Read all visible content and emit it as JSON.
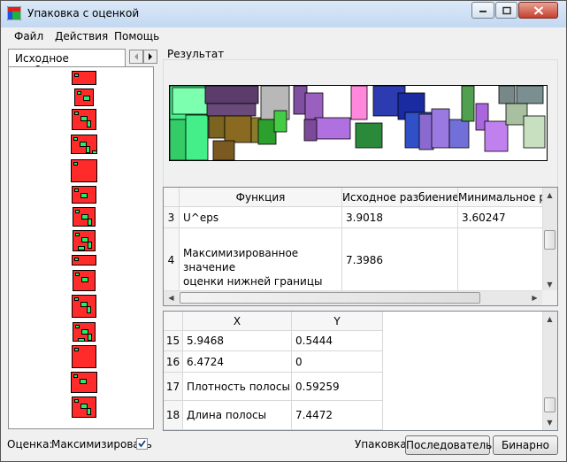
{
  "window": {
    "title": "Упаковка с оценкой"
  },
  "menu": [
    "Файл",
    "Действия",
    "Помощь"
  ],
  "left_tab": {
    "label": "Исходное разбиение"
  },
  "result_group": {
    "label": "Результат"
  },
  "functions_table": {
    "columns": [
      "Функция",
      "Исходное разбиение",
      "Минимальное р"
    ],
    "rows": [
      {
        "num": "3",
        "name": "U^eps",
        "initial": "3.9018",
        "minimal": "3.60247"
      },
      {
        "num": "4",
        "name_line1": "Максимизированное значение",
        "name_line2": "оценки нижней границы",
        "initial": "7.3986",
        "minimal": ""
      }
    ]
  },
  "points_table": {
    "columns": [
      "X",
      "Y"
    ],
    "rows": [
      {
        "num": "15",
        "x": "5.9468",
        "y": "0.5444"
      },
      {
        "num": "16",
        "x": "6.4724",
        "y": "0"
      },
      {
        "num": "17",
        "x": "Плотность полосы",
        "y": "0.59259"
      },
      {
        "num": "18",
        "x": "Длина полосы",
        "y": "7.4472"
      }
    ]
  },
  "bottom": {
    "score_label": "Оценка:",
    "maximize_label": "Максимизировать",
    "maximize_checked": true,
    "packing_label": "Упаковка:",
    "sequential_button": "Последовательно",
    "binary_button": "Бинарно"
  },
  "colors": {
    "accent_red": "#ff2a2a",
    "accent_green": "#22ee66"
  }
}
